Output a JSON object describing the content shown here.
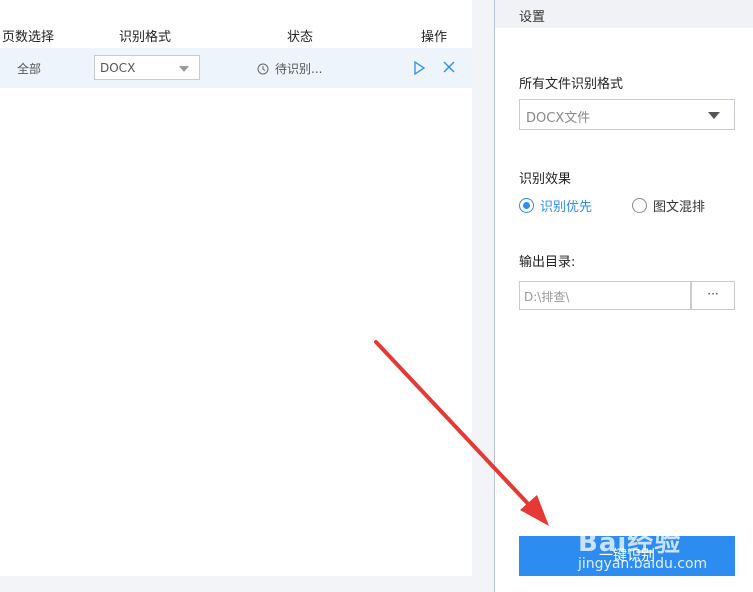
{
  "table": {
    "headers": {
      "pages": "页数选择",
      "format": "识别格式",
      "status": "状态",
      "actions": "操作"
    },
    "rows": [
      {
        "pages": "全部",
        "format": "DOCX",
        "status": "待识别..."
      }
    ]
  },
  "settings": {
    "title": "设置",
    "format_label": "所有文件识别格式",
    "format_value": "DOCX文件",
    "effect_label": "识别效果",
    "effect_options": [
      {
        "label": "识别优先",
        "checked": true
      },
      {
        "label": "图文混排",
        "checked": false
      }
    ],
    "output_label": "输出目录:",
    "output_path": "D:\\排查\\",
    "browse_label": "···",
    "run_label": "一键识别"
  },
  "watermark": {
    "brand": "Bai经验",
    "url": "jingyan.baidu.com"
  },
  "colors": {
    "accent": "#2d8cf0",
    "arrow": "#e53935",
    "row_highlight": "#eef4fb"
  }
}
